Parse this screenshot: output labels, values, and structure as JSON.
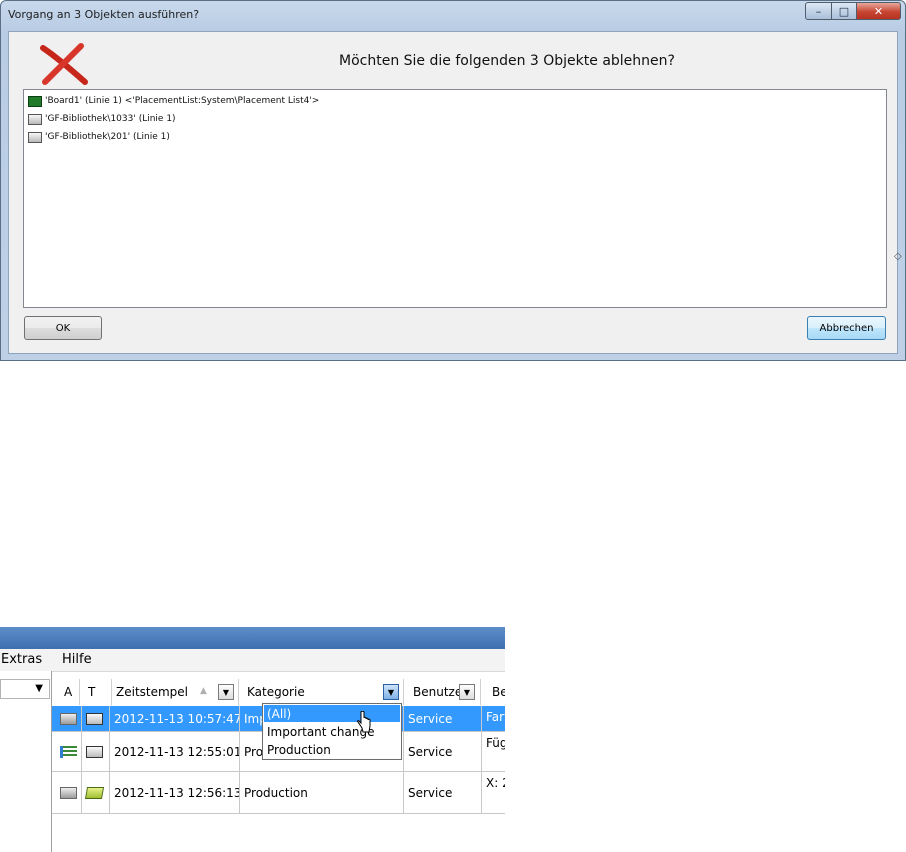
{
  "dialog": {
    "title": "Vorgang an 3 Objekten ausführen?",
    "window_buttons": {
      "minimize": "–",
      "maximize": "□",
      "close": "✕"
    },
    "question": "Möchten Sie die folgenden 3 Objekte ablehnen?",
    "items": [
      {
        "icon": "board-icon",
        "text": "'Board1' (Linie 1) <'PlacementList:System\\Placement List4'>"
      },
      {
        "icon": "library-component-icon",
        "text": "'GF-Bibliothek\\1033' (Linie 1)"
      },
      {
        "icon": "library-component-icon",
        "text": "'GF-Bibliothek\\201' (Linie 1)"
      }
    ],
    "ok_label": "OK",
    "cancel_label": "Abbrechen"
  },
  "grid_window": {
    "menu": [
      "Extras",
      "Hilfe"
    ],
    "columns": {
      "a": "A",
      "t": "T",
      "timestamp": "Zeitstempel",
      "category": "Kategorie",
      "user": "Benutze",
      "description": "Be"
    },
    "rows": [
      {
        "timestamp": "2012-11-13 10:57:47",
        "category": "Imp",
        "user": "Service",
        "description": "Fart",
        "selected": true
      },
      {
        "timestamp": "2012-11-13 12:55:01",
        "category": "Pro",
        "user": "Service",
        "description": "Füg",
        "selected": false
      },
      {
        "timestamp": "2012-11-13 12:56:13",
        "category": "Production",
        "user": "Service",
        "description": "X: 2",
        "selected": false
      }
    ],
    "category_filter": {
      "options": [
        "(All)",
        "Important change",
        "Production"
      ],
      "highlighted": "(All)"
    }
  }
}
